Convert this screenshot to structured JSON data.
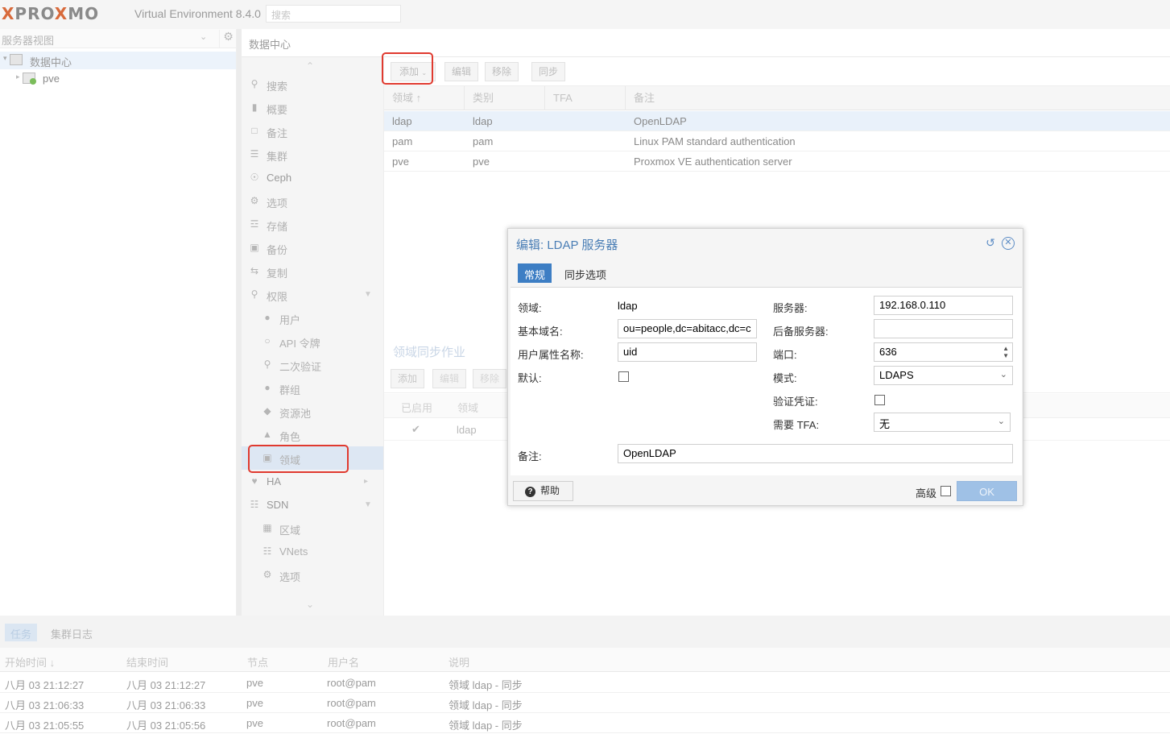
{
  "header": {
    "logo_pro": "PRO",
    "logo_x1": "X",
    "logo_mo": "MO",
    "logo_x2": "X",
    "version": "Virtual Environment 8.4.0",
    "search_placeholder": "搜索"
  },
  "tree": {
    "view_label": "服务器视图",
    "datacenter": "数据中心",
    "node": "pve"
  },
  "content_title": "数据中心",
  "nav": [
    {
      "label": "搜索",
      "icon": "search-icon"
    },
    {
      "label": "概要",
      "icon": "book-icon"
    },
    {
      "label": "备注",
      "icon": "note-icon"
    },
    {
      "label": "集群",
      "icon": "server-icon"
    },
    {
      "label": "Ceph",
      "icon": "ceph-icon"
    },
    {
      "label": "选项",
      "icon": "gear-icon"
    },
    {
      "label": "存储",
      "icon": "database-icon"
    },
    {
      "label": "备份",
      "icon": "floppy-icon"
    },
    {
      "label": "复制",
      "icon": "retweet-icon"
    },
    {
      "label": "权限",
      "icon": "unlock-icon"
    },
    {
      "label": "用户",
      "icon": "user-icon"
    },
    {
      "label": "API 令牌",
      "icon": "user-outline-icon"
    },
    {
      "label": "二次验证",
      "icon": "key-icon"
    },
    {
      "label": "群组",
      "icon": "users-icon"
    },
    {
      "label": "资源池",
      "icon": "tags-icon"
    },
    {
      "label": "角色",
      "icon": "male-icon"
    },
    {
      "label": "领域",
      "icon": "address-book-icon"
    },
    {
      "label": "HA",
      "icon": "heartbeat-icon"
    },
    {
      "label": "SDN",
      "icon": "sitemap-icon"
    },
    {
      "label": "区域",
      "icon": "th-icon"
    },
    {
      "label": "VNets",
      "icon": "network-icon"
    },
    {
      "label": "选项",
      "icon": "gear-icon"
    }
  ],
  "toolbar": {
    "add": "添加",
    "edit": "编辑",
    "remove": "移除",
    "sync": "同步"
  },
  "grid": {
    "headers": [
      "领域 ↑",
      "类别",
      "TFA",
      "备注"
    ],
    "rows": [
      {
        "realm": "ldap",
        "type": "ldap",
        "tfa": "",
        "comment": "OpenLDAP"
      },
      {
        "realm": "pam",
        "type": "pam",
        "tfa": "",
        "comment": "Linux PAM standard authentication"
      },
      {
        "realm": "pve",
        "type": "pve",
        "tfa": "",
        "comment": "Proxmox VE authentication server"
      }
    ]
  },
  "sync_panel": {
    "title": "领域同步作业",
    "add": "添加",
    "edit": "编辑",
    "remove": "移除",
    "headers": [
      "已启用",
      "领域"
    ],
    "row": {
      "enabled": "✔",
      "realm": "ldap"
    }
  },
  "dialog": {
    "title": "编辑: LDAP 服务器",
    "tabs": [
      "常规",
      "同步选项"
    ],
    "labels": {
      "realm": "领域:",
      "base_dn": "基本域名:",
      "user_attr": "用户属性名称:",
      "default": "默认:",
      "server": "服务器:",
      "fallback": "后备服务器:",
      "port": "端口:",
      "mode": "模式:",
      "verify": "验证凭证:",
      "tfa": "需要 TFA:",
      "comment": "备注:"
    },
    "values": {
      "realm": "ldap",
      "base_dn": "ou=people,dc=abitacc,dc=c",
      "user_attr": "uid",
      "server": "192.168.0.110",
      "fallback": "",
      "port": "636",
      "mode": "LDAPS",
      "tfa": "无",
      "comment": "OpenLDAP"
    },
    "help": "帮助",
    "advanced": "高级",
    "ok": "OK"
  },
  "log": {
    "tabs": [
      "任务",
      "集群日志"
    ],
    "headers": [
      "开始时间 ↓",
      "结束时间",
      "节点",
      "用户名",
      "说明"
    ],
    "rows": [
      {
        "start": "八月 03 21:12:27",
        "end": "八月 03 21:12:27",
        "node": "pve",
        "user": "root@pam",
        "desc": "领域 ldap - 同步"
      },
      {
        "start": "八月 03 21:06:33",
        "end": "八月 03 21:06:33",
        "node": "pve",
        "user": "root@pam",
        "desc": "领域 ldap - 同步"
      },
      {
        "start": "八月 03 21:05:55",
        "end": "八月 03 21:05:56",
        "node": "pve",
        "user": "root@pam",
        "desc": "领域 ldap - 同步"
      }
    ]
  },
  "colors": {
    "accent": "#3d7ec4",
    "highlight": "#e03a2f"
  }
}
